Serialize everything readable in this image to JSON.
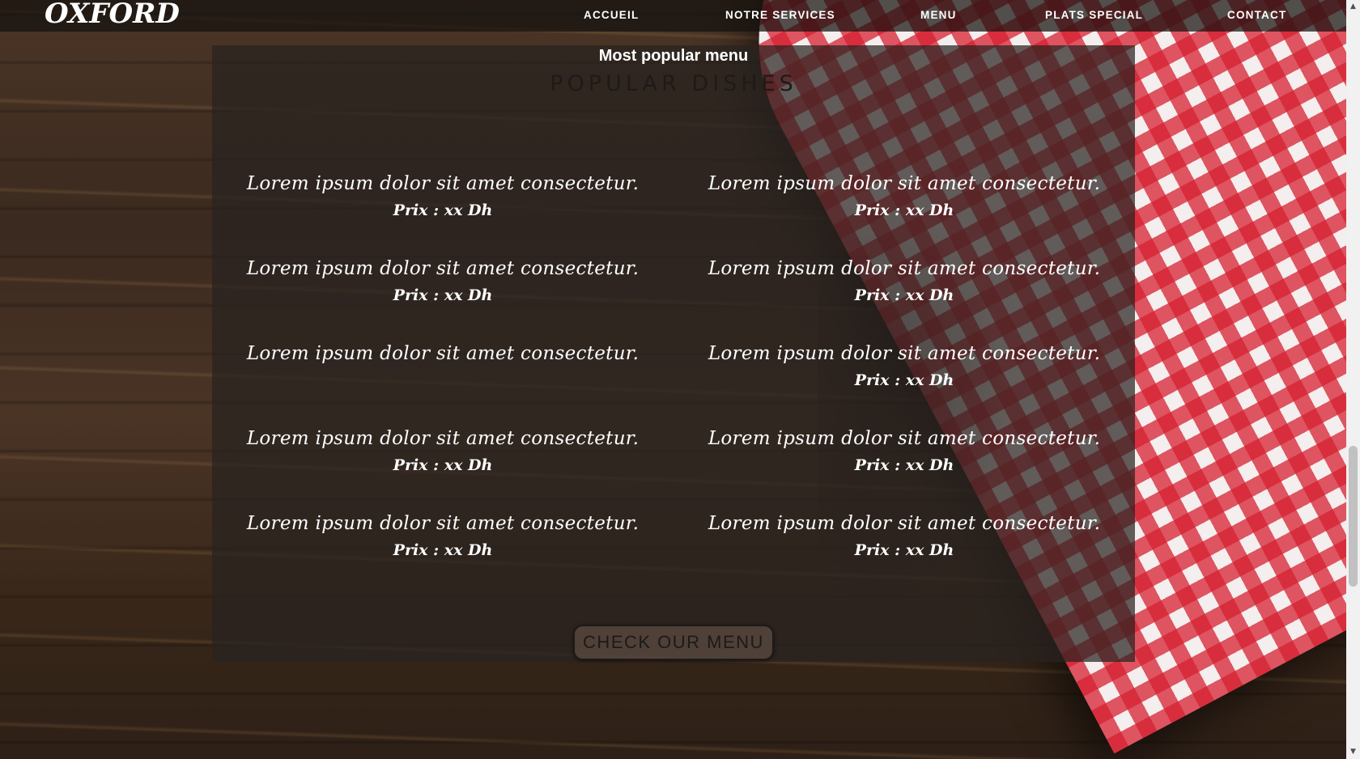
{
  "brand": {
    "logo": "OXFORD"
  },
  "nav": {
    "items": [
      {
        "label": "ACCUEIL"
      },
      {
        "label": "NOTRE SERVICES"
      },
      {
        "label": "MENU"
      },
      {
        "label": "PLATS SPECIAL"
      },
      {
        "label": "CONTACT"
      }
    ]
  },
  "section": {
    "kicker": "Most popular menu",
    "title": "POPULAR DISHES"
  },
  "dishes": [
    {
      "name": "Lorem ipsum dolor sit amet consectetur.",
      "price": "Prix : xx Dh"
    },
    {
      "name": "Lorem ipsum dolor sit amet consectetur.",
      "price": "Prix : xx Dh"
    },
    {
      "name": "Lorem ipsum dolor sit amet consectetur.",
      "price": "Prix : xx Dh"
    },
    {
      "name": "Lorem ipsum dolor sit amet consectetur.",
      "price": "Prix : xx Dh"
    },
    {
      "name": "Lorem ipsum dolor sit amet consectetur.",
      "price": ""
    },
    {
      "name": "Lorem ipsum dolor sit amet consectetur.",
      "price": "Prix : xx Dh"
    },
    {
      "name": "Lorem ipsum dolor sit amet consectetur.",
      "price": "Prix : xx Dh"
    },
    {
      "name": "Lorem ipsum dolor sit amet consectetur.",
      "price": "Prix : xx Dh"
    },
    {
      "name": "Lorem ipsum dolor sit amet consectetur.",
      "price": "Prix : xx Dh"
    },
    {
      "name": "Lorem ipsum dolor sit amet consectetur.",
      "price": "Prix : xx Dh"
    }
  ],
  "cta": {
    "label": "CHECK OUR MENU"
  },
  "icons": {
    "scroll_up": "chevron-up-icon",
    "scroll_down": "chevron-down-icon"
  },
  "colors": {
    "checker_red": "#d62030",
    "panel": "#282220",
    "text": "#ffffff"
  }
}
